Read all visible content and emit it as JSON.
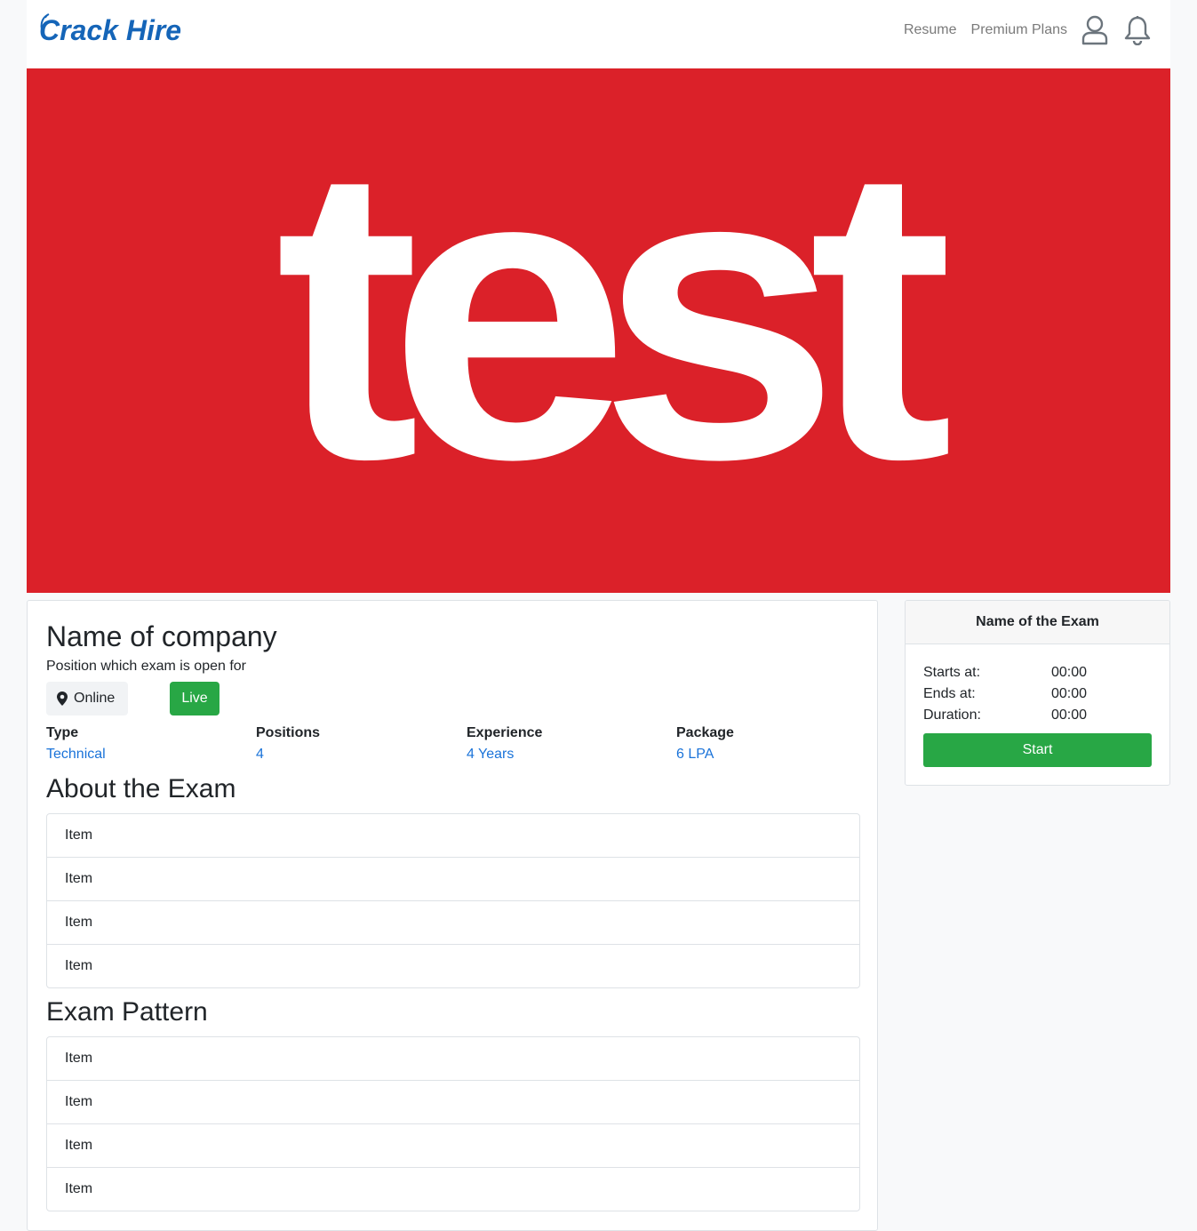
{
  "navbar": {
    "brand": "Crack Hire",
    "links": [
      "Resume",
      "Premium Plans"
    ],
    "icons": [
      "user-icon",
      "bell-icon"
    ],
    "brand_color": "#1565b8"
  },
  "banner": {
    "text": "test",
    "background_color": "#db2129"
  },
  "company": {
    "name": "Name of company",
    "position": "Position which exam is open for",
    "location": "Online",
    "status": "Live"
  },
  "meta": {
    "type_label": "Type",
    "type_value": "Technical",
    "positions_label": "Positions",
    "positions_value": "4",
    "experience_label": "Experience",
    "experience_value": "4 Years",
    "package_label": "Package",
    "package_value": "6 LPA"
  },
  "about": {
    "title": "About the Exam",
    "items": [
      "Item",
      "Item",
      "Item",
      "Item"
    ]
  },
  "pattern": {
    "title": "Exam Pattern",
    "items": [
      "Item",
      "Item",
      "Item",
      "Item"
    ]
  },
  "exam": {
    "title": "Name of the Exam",
    "starts_label": "Starts at:",
    "starts_value": "00:00",
    "ends_label": "Ends at:",
    "ends_value": "00:00",
    "duration_label": "Duration:",
    "duration_value": "00:00",
    "start_button": "Start"
  },
  "colors": {
    "accent_link": "#1a73d9",
    "success": "#28a745"
  }
}
